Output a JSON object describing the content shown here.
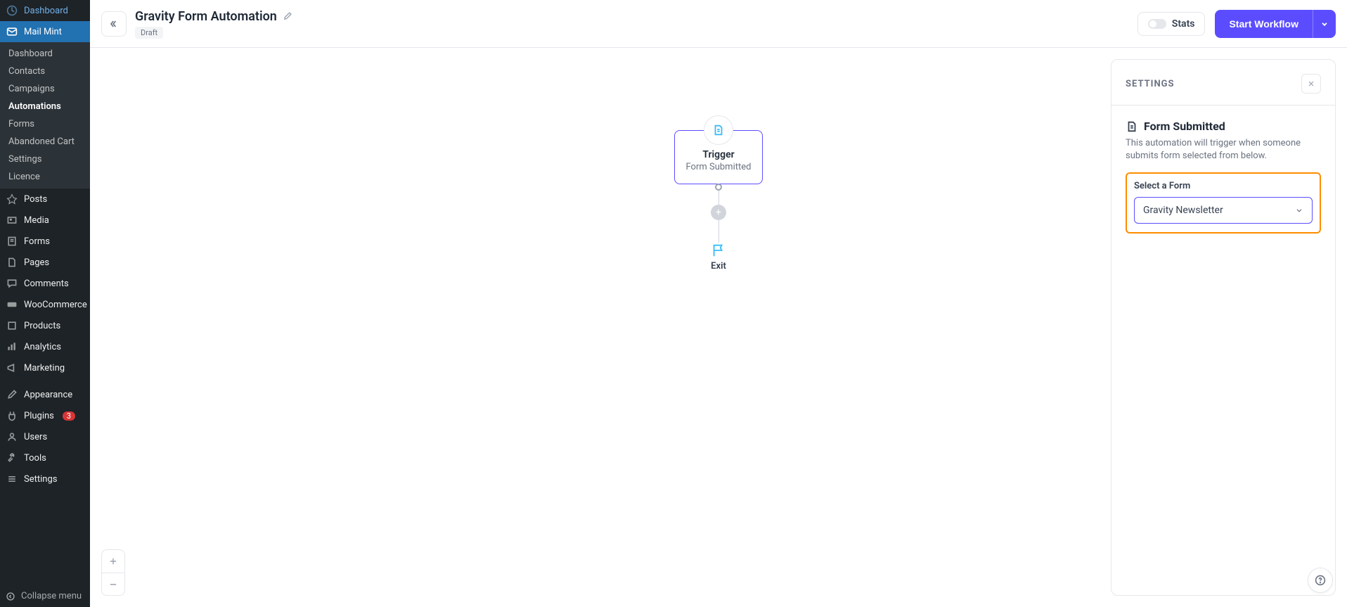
{
  "sidebar": {
    "dashboard": "Dashboard",
    "mailmint": "Mail Mint",
    "submenu": [
      "Dashboard",
      "Contacts",
      "Campaigns",
      "Automations",
      "Forms",
      "Abandoned Cart",
      "Settings",
      "Licence"
    ],
    "posts": "Posts",
    "media": "Media",
    "forms": "Forms",
    "pages": "Pages",
    "comments": "Comments",
    "woo": "WooCommerce",
    "products": "Products",
    "analytics": "Analytics",
    "marketing": "Marketing",
    "appearance": "Appearance",
    "plugins": "Plugins",
    "plugins_count": "3",
    "users": "Users",
    "tools": "Tools",
    "settings": "Settings",
    "collapse": "Collapse menu"
  },
  "topbar": {
    "title": "Gravity Form Automation",
    "draft": "Draft",
    "stats": "Stats",
    "start": "Start Workflow"
  },
  "flow": {
    "trigger_title": "Trigger",
    "trigger_sub": "Form Submitted",
    "exit": "Exit"
  },
  "panel": {
    "header": "SETTINGS",
    "section_title": "Form Submitted",
    "section_desc": "This automation will trigger when someone submits form selected from below.",
    "field_label": "Select a Form",
    "select_value": "Gravity Newsletter"
  }
}
